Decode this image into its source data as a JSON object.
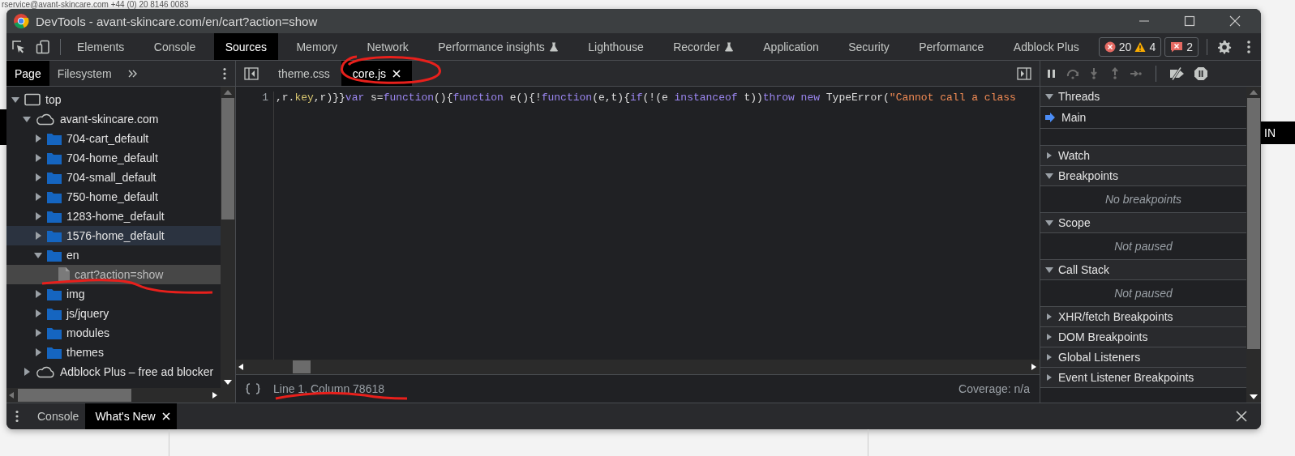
{
  "background_page": {
    "contact_line": "rservice@avant-skincare.com   +44 (0) 20 8146 0083",
    "side_text": "IN"
  },
  "window": {
    "title": "DevTools - avant-skincare.com/en/cart?action=show"
  },
  "tabs": [
    {
      "label": "Elements",
      "selected": false,
      "experimental": false
    },
    {
      "label": "Console",
      "selected": false,
      "experimental": false
    },
    {
      "label": "Sources",
      "selected": true,
      "experimental": false
    },
    {
      "label": "Memory",
      "selected": false,
      "experimental": false
    },
    {
      "label": "Network",
      "selected": false,
      "experimental": false
    },
    {
      "label": "Performance insights",
      "selected": false,
      "experimental": true
    },
    {
      "label": "Lighthouse",
      "selected": false,
      "experimental": false
    },
    {
      "label": "Recorder",
      "selected": false,
      "experimental": true
    },
    {
      "label": "Application",
      "selected": false,
      "experimental": false
    },
    {
      "label": "Security",
      "selected": false,
      "experimental": false
    },
    {
      "label": "Performance",
      "selected": false,
      "experimental": false
    },
    {
      "label": "Adblock Plus",
      "selected": false,
      "experimental": false
    }
  ],
  "issue_counts": {
    "errors": "20",
    "warnings": "4",
    "issues": "2"
  },
  "navigator": {
    "tabs": [
      {
        "label": "Page",
        "selected": true
      },
      {
        "label": "Filesystem",
        "selected": false
      }
    ],
    "tree": [
      {
        "label": "top",
        "kind": "frame",
        "expanded": true,
        "selected": false,
        "hovered": false,
        "children": [
          {
            "label": "avant-skincare.com",
            "kind": "domain",
            "expanded": true,
            "selected": false,
            "hovered": false,
            "children": [
              {
                "label": "704-cart_default",
                "kind": "folder",
                "expanded": false,
                "selected": false,
                "hovered": false
              },
              {
                "label": "704-home_default",
                "kind": "folder",
                "expanded": false,
                "selected": false,
                "hovered": false
              },
              {
                "label": "704-small_default",
                "kind": "folder",
                "expanded": false,
                "selected": false,
                "hovered": false
              },
              {
                "label": "750-home_default",
                "kind": "folder",
                "expanded": false,
                "selected": false,
                "hovered": false
              },
              {
                "label": "1283-home_default",
                "kind": "folder",
                "expanded": false,
                "selected": false,
                "hovered": false
              },
              {
                "label": "1576-home_default",
                "kind": "folder",
                "expanded": false,
                "selected": false,
                "hovered": true
              },
              {
                "label": "en",
                "kind": "folder",
                "expanded": true,
                "selected": false,
                "hovered": false,
                "children": [
                  {
                    "label": "cart?action=show",
                    "kind": "file",
                    "selected": true,
                    "hovered": false
                  }
                ]
              },
              {
                "label": "img",
                "kind": "folder",
                "expanded": false,
                "selected": false,
                "hovered": false
              },
              {
                "label": "js/jquery",
                "kind": "folder",
                "expanded": false,
                "selected": false,
                "hovered": false
              },
              {
                "label": "modules",
                "kind": "folder",
                "expanded": false,
                "selected": false,
                "hovered": false
              },
              {
                "label": "themes",
                "kind": "folder",
                "expanded": false,
                "selected": false,
                "hovered": false
              }
            ]
          },
          {
            "label": "Adblock Plus – free ad blocker",
            "kind": "domain",
            "expanded": false,
            "selected": false,
            "hovered": false
          }
        ]
      }
    ]
  },
  "editor": {
    "file_tabs": [
      {
        "label": "theme.css",
        "selected": false
      },
      {
        "label": "core.js",
        "selected": true
      }
    ],
    "line_number": "1",
    "code": [
      {
        "kind": "plain",
        "text": ",r."
      },
      {
        "kind": "property",
        "text": "key"
      },
      {
        "kind": "plain",
        "text": ",r)}}"
      },
      {
        "kind": "keyword",
        "text": "var"
      },
      {
        "kind": "plain",
        "text": " s="
      },
      {
        "kind": "keyword",
        "text": "function"
      },
      {
        "kind": "plain",
        "text": "(){"
      },
      {
        "kind": "keyword",
        "text": "function"
      },
      {
        "kind": "plain",
        "text": " e(){!"
      },
      {
        "kind": "keyword",
        "text": "function"
      },
      {
        "kind": "plain",
        "text": "(e,t){"
      },
      {
        "kind": "keyword",
        "text": "if"
      },
      {
        "kind": "plain",
        "text": "(!(e "
      },
      {
        "kind": "keyword",
        "text": "instanceof"
      },
      {
        "kind": "plain",
        "text": " t))"
      },
      {
        "kind": "keyword",
        "text": "throw new"
      },
      {
        "kind": "plain",
        "text": " TypeError("
      },
      {
        "kind": "string",
        "text": "\"Cannot call a class"
      }
    ],
    "position": "Line 1, Column 78618",
    "coverage": "Coverage: n/a"
  },
  "debugger_sections": [
    {
      "title": "Threads",
      "expanded": true,
      "threads": [
        {
          "label": "Main",
          "selected": true
        }
      ]
    },
    {
      "title": "Watch",
      "expanded": false
    },
    {
      "title": "Breakpoints",
      "expanded": true,
      "message": "No breakpoints"
    },
    {
      "title": "Scope",
      "expanded": true,
      "message": "Not paused"
    },
    {
      "title": "Call Stack",
      "expanded": true,
      "message": "Not paused"
    },
    {
      "title": "XHR/fetch Breakpoints",
      "expanded": false
    },
    {
      "title": "DOM Breakpoints",
      "expanded": false
    },
    {
      "title": "Global Listeners",
      "expanded": false
    },
    {
      "title": "Event Listener Breakpoints",
      "expanded": false
    }
  ],
  "drawer": {
    "tabs": [
      {
        "label": "Console",
        "selected": false,
        "closable": false
      },
      {
        "label": "What's New",
        "selected": true,
        "closable": true
      }
    ]
  }
}
